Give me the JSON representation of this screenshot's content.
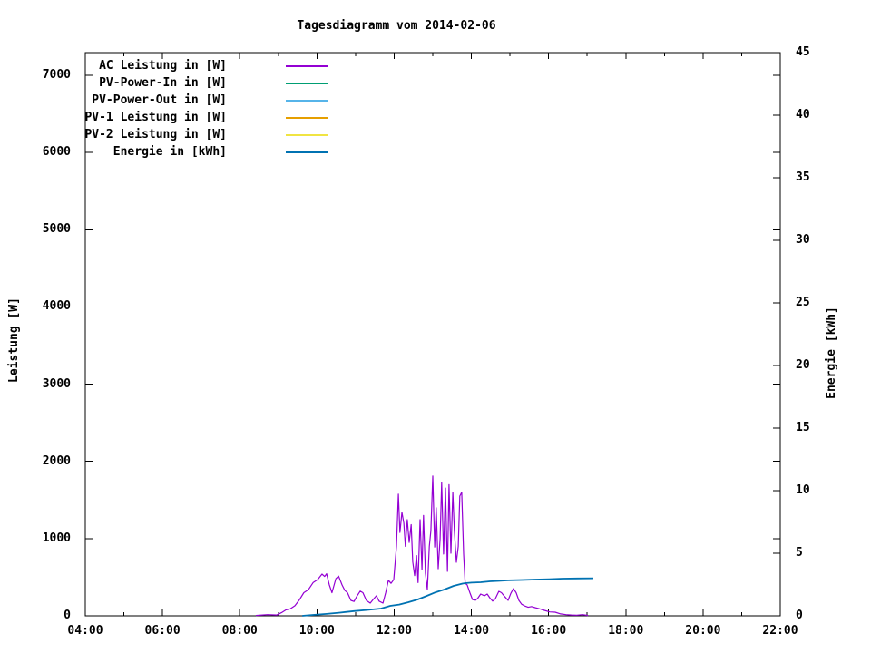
{
  "chart_data": {
    "type": "line",
    "title": "Tagesdiagramm vom 2014-02-06",
    "x_axis": {
      "label": "",
      "tick_values": [
        4,
        6,
        8,
        10,
        12,
        14,
        16,
        18,
        20,
        22
      ],
      "tick_labels": [
        "04:00",
        "06:00",
        "08:00",
        "10:00",
        "12:00",
        "14:00",
        "16:00",
        "18:00",
        "20:00",
        "22:00"
      ],
      "minor_tick_every_hours": 1,
      "range_hours": [
        4,
        22
      ]
    },
    "y_axis_left": {
      "label": "Leistung [W]",
      "tick_values": [
        0,
        1000,
        2000,
        3000,
        4000,
        5000,
        6000,
        7000
      ],
      "tick_labels": [
        "0",
        "1000",
        "2000",
        "3000",
        "4000",
        "5000",
        "6000",
        "7000"
      ],
      "range": [
        0,
        7294
      ]
    },
    "y_axis_right": {
      "label": "Energie [kWh]",
      "tick_values": [
        0,
        5,
        10,
        15,
        20,
        25,
        30,
        35,
        40,
        45
      ],
      "tick_labels": [
        "0",
        "5",
        "10",
        "15",
        "20",
        "25",
        "30",
        "35",
        "40",
        "45"
      ],
      "range": [
        0,
        45
      ]
    },
    "grid": "off",
    "legend_position": "top-left-inside",
    "series": [
      {
        "name": "AC Leistung in [W]",
        "color": "#9400D3",
        "axis": "left",
        "x": [
          8.42,
          8.72,
          8.96,
          9.08,
          9.19,
          9.31,
          9.43,
          9.55,
          9.66,
          9.78,
          9.9,
          10.02,
          10.13,
          10.2,
          10.25,
          10.32,
          10.39,
          10.49,
          10.56,
          10.65,
          10.72,
          10.79,
          10.88,
          10.96,
          11.03,
          11.12,
          11.19,
          11.28,
          11.38,
          11.47,
          11.54,
          11.61,
          11.71,
          11.78,
          11.85,
          11.92,
          11.99,
          12.06,
          12.11,
          12.15,
          12.2,
          12.25,
          12.29,
          12.34,
          12.39,
          12.44,
          12.48,
          12.53,
          12.58,
          12.62,
          12.67,
          12.72,
          12.76,
          12.81,
          12.86,
          12.91,
          12.95,
          13.0,
          13.05,
          13.09,
          13.14,
          13.19,
          13.23,
          13.28,
          13.33,
          13.38,
          13.42,
          13.47,
          13.52,
          13.56,
          13.61,
          13.66,
          13.7,
          13.75,
          13.8,
          13.84,
          13.89,
          13.96,
          14.03,
          14.1,
          14.17,
          14.24,
          14.34,
          14.41,
          14.48,
          14.55,
          14.62,
          14.71,
          14.78,
          14.86,
          14.95,
          15.02,
          15.09,
          15.16,
          15.23,
          15.3,
          15.37,
          15.47,
          15.56,
          15.65,
          15.77,
          15.89,
          16.03,
          16.17,
          16.31,
          16.45,
          16.59,
          16.73,
          16.88,
          17.02
        ],
        "y": [
          5,
          15,
          10,
          40,
          75,
          90,
          130,
          210,
          300,
          340,
          430,
          470,
          540,
          510,
          545,
          400,
          300,
          480,
          515,
          400,
          330,
          300,
          200,
          185,
          250,
          320,
          300,
          200,
          165,
          220,
          260,
          190,
          165,
          300,
          460,
          420,
          470,
          900,
          1575,
          1080,
          1340,
          1200,
          900,
          1245,
          950,
          1180,
          700,
          520,
          780,
          430,
          1245,
          600,
          1300,
          550,
          340,
          900,
          1100,
          1810,
          890,
          1400,
          610,
          1000,
          1725,
          800,
          1655,
          575,
          1700,
          810,
          1600,
          1100,
          693,
          900,
          1550,
          1600,
          800,
          420,
          400,
          300,
          210,
          200,
          230,
          282,
          260,
          282,
          230,
          190,
          220,
          317,
          300,
          250,
          200,
          290,
          352,
          300,
          200,
          150,
          130,
          110,
          120,
          106,
          90,
          70,
          50,
          47,
          25,
          15,
          10,
          8,
          15,
          5
        ]
      },
      {
        "name": "PV-Power-In in [W]",
        "color": "#009E73",
        "axis": "left",
        "x": [],
        "y": []
      },
      {
        "name": "PV-Power-Out in [W]",
        "color": "#56B4E9",
        "axis": "left",
        "x": [],
        "y": []
      },
      {
        "name": "PV-1 Leistung in [W]",
        "color": "#E69F00",
        "axis": "left",
        "x": [],
        "y": []
      },
      {
        "name": "PV-2 Leistung in [W]",
        "color": "#F0E442",
        "axis": "left",
        "x": [],
        "y": []
      },
      {
        "name": "Energie in [kWh]",
        "color": "#0072B2",
        "axis": "right",
        "x": [
          9.62,
          9.9,
          10.25,
          10.6,
          10.96,
          11.31,
          11.66,
          11.9,
          12.13,
          12.37,
          12.6,
          12.84,
          13.07,
          13.3,
          13.54,
          13.77,
          13.84,
          14.01,
          14.24,
          14.48,
          14.71,
          14.95,
          15.3,
          15.65,
          16.01,
          16.36,
          17.16
        ],
        "y": [
          0.0,
          0.07,
          0.15,
          0.25,
          0.38,
          0.47,
          0.58,
          0.8,
          0.9,
          1.09,
          1.3,
          1.59,
          1.88,
          2.1,
          2.39,
          2.57,
          2.61,
          2.65,
          2.68,
          2.75,
          2.79,
          2.83,
          2.86,
          2.9,
          2.93,
          2.97,
          3.0
        ]
      }
    ],
    "colors": {
      "border": "#000000",
      "background": "#ffffff"
    }
  }
}
